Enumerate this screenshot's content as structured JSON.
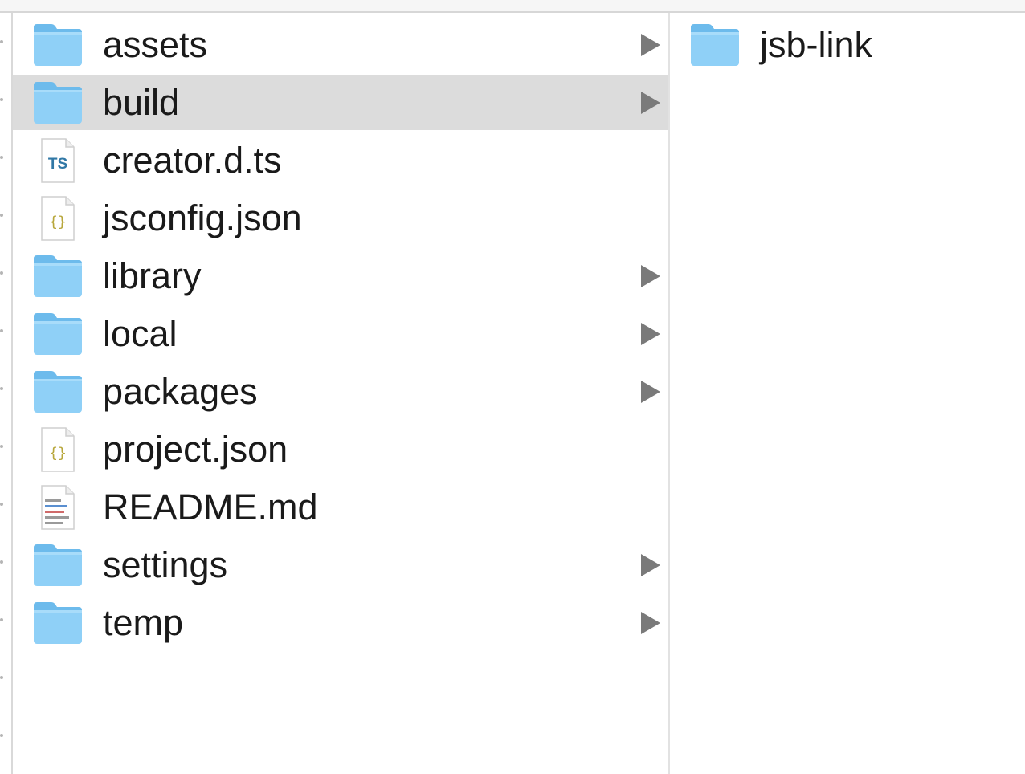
{
  "main_column": {
    "items": [
      {
        "name": "assets",
        "type": "folder",
        "has_children": true,
        "selected": false
      },
      {
        "name": "build",
        "type": "folder",
        "has_children": true,
        "selected": true
      },
      {
        "name": "creator.d.ts",
        "type": "ts-file",
        "has_children": false,
        "selected": false
      },
      {
        "name": "jsconfig.json",
        "type": "json-file",
        "has_children": false,
        "selected": false
      },
      {
        "name": "library",
        "type": "folder",
        "has_children": true,
        "selected": false
      },
      {
        "name": "local",
        "type": "folder",
        "has_children": true,
        "selected": false
      },
      {
        "name": "packages",
        "type": "folder",
        "has_children": true,
        "selected": false
      },
      {
        "name": "project.json",
        "type": "json-file",
        "has_children": false,
        "selected": false
      },
      {
        "name": "README.md",
        "type": "md-file",
        "has_children": false,
        "selected": false
      },
      {
        "name": "settings",
        "type": "folder",
        "has_children": true,
        "selected": false
      },
      {
        "name": "temp",
        "type": "folder",
        "has_children": true,
        "selected": false
      }
    ]
  },
  "detail_column": {
    "items": [
      {
        "name": "jsb-link",
        "type": "folder",
        "has_children": false,
        "selected": false
      }
    ]
  },
  "icons": {
    "folder": "folder-icon",
    "ts-file": "typescript-file-icon",
    "json-file": "json-file-icon",
    "md-file": "markdown-file-icon"
  },
  "colors": {
    "folder_body": "#8fd0f7",
    "folder_tab": "#6dbbec",
    "selection": "#dcdcdc",
    "chevron": "#7a7a7a",
    "ts_text": "#3178a6",
    "json_text": "#b7a63a"
  }
}
